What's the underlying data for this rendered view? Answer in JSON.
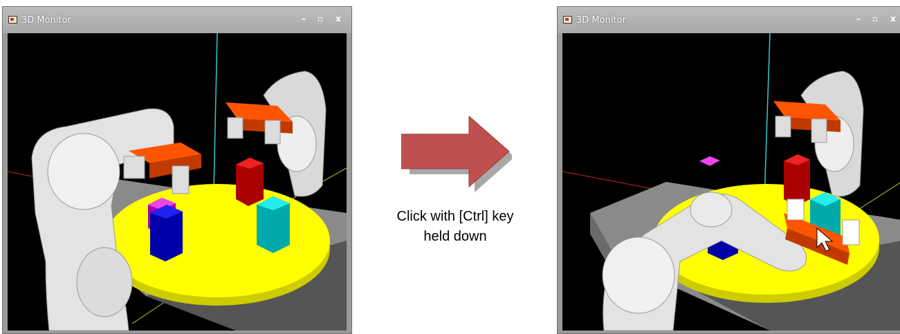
{
  "windows": [
    {
      "id": "before",
      "title": "3D Monitor",
      "minimize_label": "–",
      "maximize_label": "▫",
      "close_label": "x",
      "view": "robot-idle-above-table"
    },
    {
      "id": "after",
      "title": "3D Monitor",
      "minimize_label": "–",
      "maximize_label": "▫",
      "close_label": "x",
      "view": "robot-reaching-to-cursor"
    }
  ],
  "arrow": {
    "color": "#c0504d",
    "icon": "right-arrow-icon"
  },
  "caption": {
    "line1": "Click with [Ctrl] key",
    "line2": "held down"
  },
  "scene_colors": {
    "background": "#000000",
    "table": "#ffff00",
    "robot": "#e8e8e8",
    "gripper": "#e05010",
    "blue_block": "#0000cc",
    "magenta_block": "#cc00cc",
    "red_block": "#cc0000",
    "cyan_block": "#00cccc"
  }
}
